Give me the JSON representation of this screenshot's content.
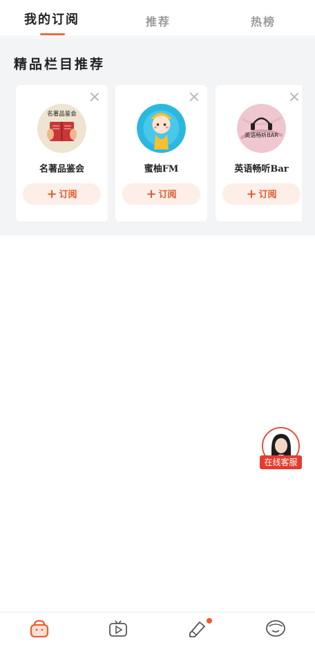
{
  "header": {
    "tabs": [
      {
        "label": "我的订阅",
        "active": true
      },
      {
        "label": "推荐",
        "active": false
      },
      {
        "label": "热榜",
        "active": false
      }
    ]
  },
  "recommend": {
    "title": "精品栏目推荐",
    "cards": [
      {
        "name": "名著品鉴会",
        "cover_text": "名著品鉴会",
        "button": "订阅"
      },
      {
        "name": "蜜柚FM",
        "cover_text": "",
        "button": "订阅"
      },
      {
        "name": "英语畅听Bar",
        "cover_text": "英语畅听BAR",
        "button": "订阅"
      }
    ]
  },
  "customer_service": {
    "label": "在线客服"
  },
  "bottom_nav": {
    "items": [
      {
        "label": "",
        "icon": "bag-icon",
        "active": true
      },
      {
        "label": "",
        "icon": "video-icon",
        "active": false
      },
      {
        "label": "",
        "icon": "pencil-icon",
        "active": false,
        "badge": true
      },
      {
        "label": "",
        "icon": "face-icon",
        "active": false
      }
    ]
  },
  "colors": {
    "accent": "#ef5b30",
    "background": "#f3f4f6"
  }
}
